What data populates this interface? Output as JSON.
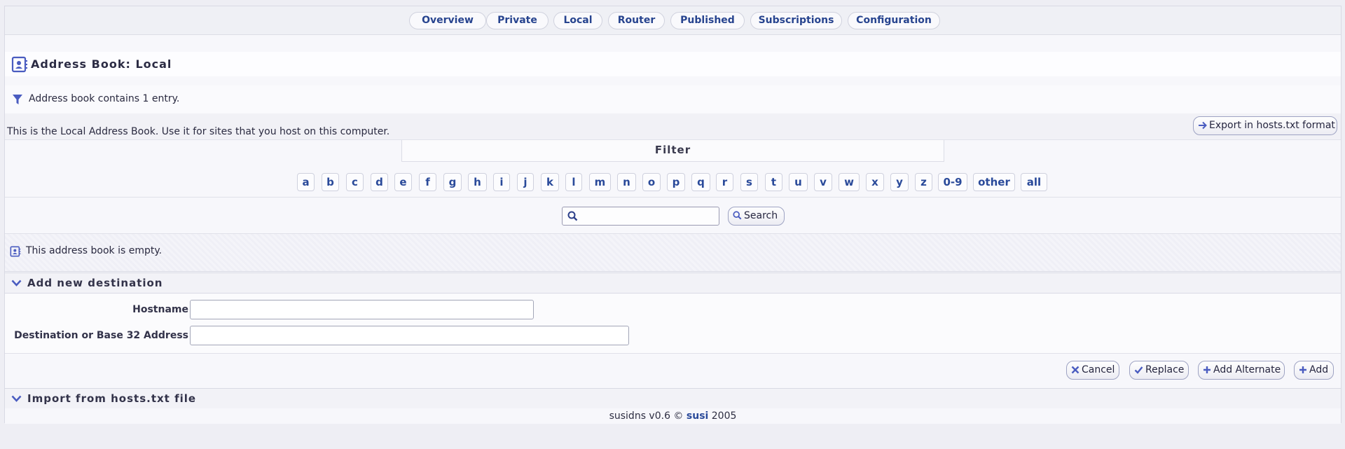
{
  "nav": {
    "tabs": [
      {
        "label": "Overview"
      },
      {
        "label": "Private"
      },
      {
        "label": "Local"
      },
      {
        "label": "Router"
      },
      {
        "label": "Published"
      },
      {
        "label": "Subscriptions"
      },
      {
        "label": "Configuration"
      }
    ]
  },
  "page": {
    "title": "Address Book: Local",
    "count_text": "Address book contains 1 entry.",
    "description": "This is the Local Address Book. Use it for sites that you host on this computer.",
    "export_label": "Export in hosts.txt format"
  },
  "filter": {
    "heading": "Filter",
    "letters": [
      "a",
      "b",
      "c",
      "d",
      "e",
      "f",
      "g",
      "h",
      "i",
      "j",
      "k",
      "l",
      "m",
      "n",
      "o",
      "p",
      "q",
      "r",
      "s",
      "t",
      "u",
      "v",
      "w",
      "x",
      "y",
      "z",
      "0-9",
      "other",
      "all"
    ]
  },
  "search": {
    "value": "",
    "button_label": "Search"
  },
  "empty_text": "This address book is empty.",
  "add_section": {
    "title": "Add new destination",
    "hostname_label": "Hostname",
    "hostname_value": "",
    "destination_label": "Destination or Base 32 Address",
    "destination_value": "",
    "cancel_label": "Cancel",
    "replace_label": "Replace",
    "add_alternate_label": "Add Alternate",
    "add_label": "Add"
  },
  "import_section": {
    "title": "Import from hosts.txt file"
  },
  "footer": {
    "prefix": "susidns v0.6 © ",
    "link": "susi",
    "suffix": " 2005"
  },
  "colors": {
    "accent": "#2a4a9a",
    "icon": "#4a5cc0",
    "background": "#eeeef4"
  }
}
